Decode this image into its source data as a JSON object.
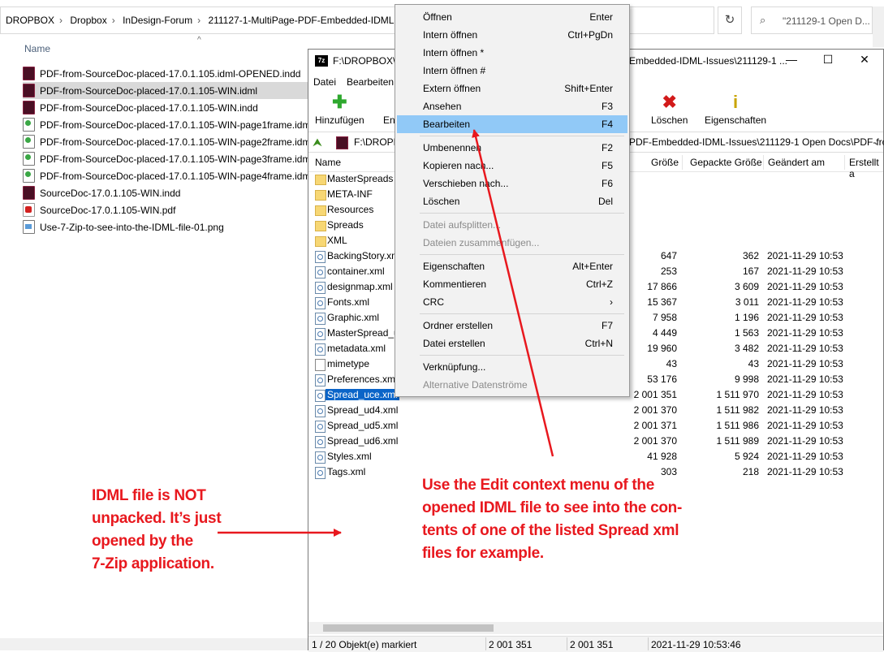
{
  "explorer": {
    "breadcrumbs": [
      "DROPBOX",
      "Dropbox",
      "InDesign-Forum",
      "211127-1-MultiPage-PDF-Embedded-IDML"
    ],
    "search_placeholder": "\"211129-1 Open D...",
    "column_name": "Name",
    "files": [
      {
        "name": "PDF-from-SourceDoc-placed-17.0.1.105.idml-OPENED.indd",
        "icon": "indd-file-icon"
      },
      {
        "name": "PDF-from-SourceDoc-placed-17.0.1.105-WIN.idml",
        "icon": "indd-file-icon"
      },
      {
        "name": "PDF-from-SourceDoc-placed-17.0.1.105-WIN.indd",
        "icon": "indd-file-icon"
      },
      {
        "name": "PDF-from-SourceDoc-placed-17.0.1.105-WIN-page1frame.idml",
        "icon": "idml-file-icon"
      },
      {
        "name": "PDF-from-SourceDoc-placed-17.0.1.105-WIN-page2frame.idml",
        "icon": "idml-file-icon"
      },
      {
        "name": "PDF-from-SourceDoc-placed-17.0.1.105-WIN-page3frame.idml",
        "icon": "idml-file-icon"
      },
      {
        "name": "PDF-from-SourceDoc-placed-17.0.1.105-WIN-page4frame.idml",
        "icon": "idml-file-icon"
      },
      {
        "name": "SourceDoc-17.0.1.105-WIN.indd",
        "icon": "indd-file-icon"
      },
      {
        "name": "SourceDoc-17.0.1.105-WIN.pdf",
        "icon": "pdf-file-icon"
      },
      {
        "name": "Use-7-Zip-to-see-into-the-IDML-file-01.png",
        "icon": "png-file-icon"
      }
    ]
  },
  "zip": {
    "title_icon": "7z",
    "title_left": "F:\\DROPBOX\\D",
    "title_right": "Embedded-IDML-Issues\\211129-1 ...",
    "menus": [
      "Datei",
      "Bearbeiten"
    ],
    "toolbar": {
      "add": "Hinzufügen",
      "extract_partial": "En",
      "delete": "Löschen",
      "properties": "Eigenschaften"
    },
    "path_left": "F:\\DROPB",
    "path_right": "PDF-Embedded-IDML-Issues\\211129-1 Open Docs\\PDF-fro",
    "columns": {
      "name": "Name",
      "size": "Größe",
      "packed": "Gepackte Größe",
      "modified": "Geändert am",
      "created": "Erstellt a"
    },
    "entries": [
      {
        "name": "MasterSpreads",
        "type": "folder",
        "size": "",
        "packed": "",
        "date": ""
      },
      {
        "name": "META-INF",
        "type": "folder",
        "size": "",
        "packed": "",
        "date": ""
      },
      {
        "name": "Resources",
        "type": "folder",
        "size": "",
        "packed": "",
        "date": ""
      },
      {
        "name": "Spreads",
        "type": "folder",
        "size": "",
        "packed": "",
        "date": ""
      },
      {
        "name": "XML",
        "type": "folder",
        "size": "",
        "packed": "",
        "date": ""
      },
      {
        "name": "BackingStory.xml",
        "type": "xml",
        "size": "647",
        "packed": "362",
        "date": "2021-11-29 10:53"
      },
      {
        "name": "container.xml",
        "type": "xml",
        "size": "253",
        "packed": "167",
        "date": "2021-11-29 10:53"
      },
      {
        "name": "designmap.xml",
        "type": "xml",
        "size": "17 866",
        "packed": "3 609",
        "date": "2021-11-29 10:53"
      },
      {
        "name": "Fonts.xml",
        "type": "xml",
        "size": "15 367",
        "packed": "3 011",
        "date": "2021-11-29 10:53"
      },
      {
        "name": "Graphic.xml",
        "type": "xml",
        "size": "7 958",
        "packed": "1 196",
        "date": "2021-11-29 10:53"
      },
      {
        "name": "MasterSpread_u",
        "type": "xml",
        "size": "4 449",
        "packed": "1 563",
        "date": "2021-11-29 10:53"
      },
      {
        "name": "metadata.xml",
        "type": "xml",
        "size": "19 960",
        "packed": "3 482",
        "date": "2021-11-29 10:53"
      },
      {
        "name": "mimetype",
        "type": "plain",
        "size": "43",
        "packed": "43",
        "date": "2021-11-29 10:53"
      },
      {
        "name": "Preferences.xml",
        "type": "xml",
        "size": "53 176",
        "packed": "9 998",
        "date": "2021-11-29 10:53"
      },
      {
        "name": "Spread_uce.xml",
        "type": "xml",
        "size": "2 001 351",
        "packed": "1 511 970",
        "date": "2021-11-29 10:53",
        "selected": true
      },
      {
        "name": "Spread_ud4.xml",
        "type": "xml",
        "size": "2 001 370",
        "packed": "1 511 982",
        "date": "2021-11-29 10:53"
      },
      {
        "name": "Spread_ud5.xml",
        "type": "xml",
        "size": "2 001 371",
        "packed": "1 511 986",
        "date": "2021-11-29 10:53"
      },
      {
        "name": "Spread_ud6.xml",
        "type": "xml",
        "size": "2 001 370",
        "packed": "1 511 989",
        "date": "2021-11-29 10:53"
      },
      {
        "name": "Styles.xml",
        "type": "xml",
        "size": "41 928",
        "packed": "5 924",
        "date": "2021-11-29 10:53"
      },
      {
        "name": "Tags.xml",
        "type": "xml",
        "size": "303",
        "packed": "218",
        "date": "2021-11-29 10:53"
      }
    ],
    "status": {
      "selection": "1 / 20 Objekt(e) markiert",
      "size": "2 001 351",
      "packed": "2 001 351",
      "datetime": "2021-11-29 10:53:46"
    }
  },
  "context_menu": {
    "items": [
      {
        "label": "Öffnen",
        "shortcut": "Enter"
      },
      {
        "label": "Intern öffnen",
        "shortcut": "Ctrl+PgDn"
      },
      {
        "label": "Intern öffnen *",
        "shortcut": ""
      },
      {
        "label": "Intern öffnen #",
        "shortcut": ""
      },
      {
        "label": "Extern öffnen",
        "shortcut": "Shift+Enter"
      },
      {
        "label": "Ansehen",
        "shortcut": "F3"
      },
      {
        "label": "Bearbeiten",
        "shortcut": "F4",
        "highlighted": true
      },
      {
        "sep": true
      },
      {
        "label": "Umbenennen",
        "shortcut": "F2"
      },
      {
        "label": "Kopieren nach...",
        "shortcut": "F5"
      },
      {
        "label": "Verschieben nach...",
        "shortcut": "F6"
      },
      {
        "label": "Löschen",
        "shortcut": "Del"
      },
      {
        "sep": true
      },
      {
        "label": "Datei aufsplitten...",
        "shortcut": "",
        "disabled": true
      },
      {
        "label": "Dateien zusammenfügen...",
        "shortcut": "",
        "disabled": true
      },
      {
        "sep": true
      },
      {
        "label": "Eigenschaften",
        "shortcut": "Alt+Enter"
      },
      {
        "label": "Kommentieren",
        "shortcut": "Ctrl+Z"
      },
      {
        "label": "CRC",
        "shortcut": "›"
      },
      {
        "sep": true
      },
      {
        "label": "Ordner erstellen",
        "shortcut": "F7"
      },
      {
        "label": "Datei erstellen",
        "shortcut": "Ctrl+N"
      },
      {
        "sep": true
      },
      {
        "label": "Verknüpfung...",
        "shortcut": ""
      },
      {
        "label": "Alternative Datenströme",
        "shortcut": "",
        "disabled": true
      }
    ]
  },
  "annotations": {
    "left_note": "IDML file is NOT\nunpacked. It’s just\nopened by the\n7-Zip application.",
    "right_note": "Use the Edit context menu of the\nopened IDML file to see into the con-\ntents of one of the listed Spread xml\nfiles for example.",
    "color": "#e8181e"
  }
}
